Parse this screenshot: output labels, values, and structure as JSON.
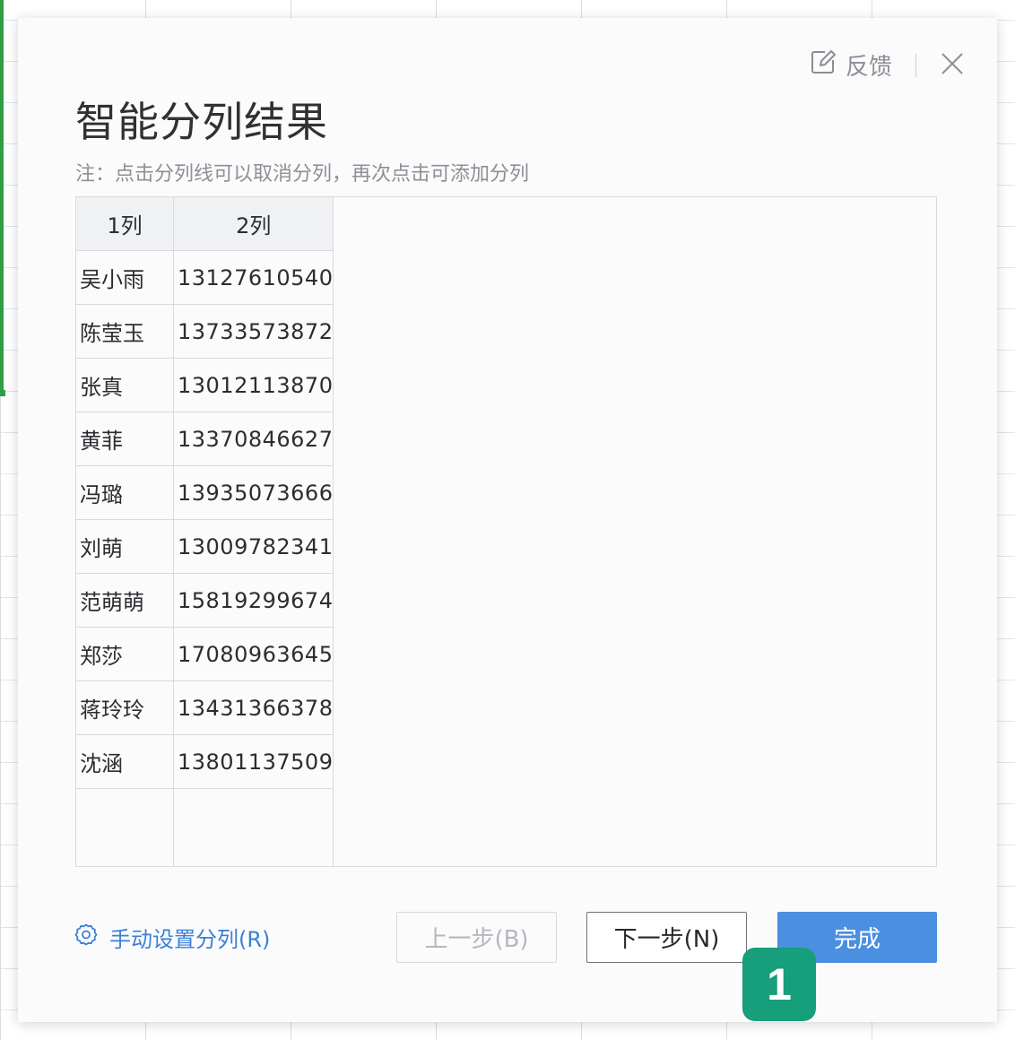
{
  "dialog": {
    "title": "智能分列结果",
    "note": "注：点击分列线可以取消分列，再次点击可添加分列",
    "feedback_label": "反馈"
  },
  "table": {
    "headers": [
      "1列",
      "2列"
    ],
    "rows": [
      [
        "吴小雨",
        "13127610540"
      ],
      [
        "陈莹玉",
        "13733573872"
      ],
      [
        "张真",
        "13012113870"
      ],
      [
        "黄菲",
        "13370846627"
      ],
      [
        "冯璐",
        "13935073666"
      ],
      [
        "刘萌",
        "13009782341"
      ],
      [
        "范萌萌",
        "15819299674"
      ],
      [
        "郑莎",
        "17080963645"
      ],
      [
        "蒋玲玲",
        "13431366378"
      ],
      [
        "沈涵",
        "13801137509"
      ]
    ]
  },
  "footer": {
    "manual_split_label": "手动设置分列(R)",
    "prev_label": "上一步(B)",
    "next_label": "下一步(N)",
    "done_label": "完成"
  },
  "annotation": {
    "step_number": "1"
  },
  "colors": {
    "accent": "#4a8fe0",
    "link": "#3c7fd8",
    "badge": "#179e7a",
    "sheet_selection": "#2f9e44"
  },
  "icons": [
    "edit-icon",
    "close-icon",
    "gear-icon"
  ]
}
